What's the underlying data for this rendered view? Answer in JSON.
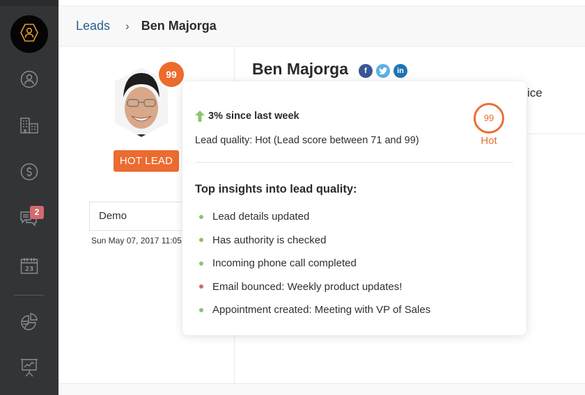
{
  "sidebar": {
    "items": [
      {
        "name": "home",
        "icon": "hexagon-user-icon",
        "active": true
      },
      {
        "name": "contacts",
        "icon": "user-circle-icon"
      },
      {
        "name": "accounts",
        "icon": "buildings-icon"
      },
      {
        "name": "deals",
        "icon": "dollar-circle-icon"
      },
      {
        "name": "messages",
        "icon": "chat-bubbles-icon",
        "badge": "2"
      },
      {
        "name": "calendar",
        "icon": "calendar-icon",
        "calendar_day": "23"
      },
      {
        "name": "reports",
        "icon": "pie-chart-icon"
      },
      {
        "name": "analytics",
        "icon": "presentation-chart-icon"
      }
    ]
  },
  "breadcrumb": {
    "parent": "Leads",
    "separator": "›",
    "current": "Ben Majorga"
  },
  "lead": {
    "name": "Ben Majorga",
    "score": "99",
    "status_label": "HOT LEAD",
    "social": {
      "facebook": "f",
      "twitter": "t",
      "linkedin": "in"
    },
    "partial_text": "ice"
  },
  "left_panel": {
    "stage_value": "Demo",
    "date": "Sun May 07, 2017 11:05"
  },
  "popover": {
    "trend": "3% since last week",
    "quality_text": "Lead quality: Hot (Lead score between 71 and 99)",
    "score": "99",
    "score_label": "Hot",
    "insights_title": "Top insights into lead quality:",
    "insights": [
      {
        "text": "Lead details updated",
        "sentiment": "positive"
      },
      {
        "text": "Has authority is checked",
        "sentiment": "positive"
      },
      {
        "text": "Incoming phone call completed",
        "sentiment": "positive"
      },
      {
        "text": "Email bounced: Weekly product updates!",
        "sentiment": "negative"
      },
      {
        "text": "Appointment created: Meeting with VP of Sales",
        "sentiment": "positive"
      }
    ]
  },
  "colors": {
    "accent": "#ec6b2d",
    "positive": "#8cc46a",
    "negative": "#d06a6e",
    "link": "#2a5f8f",
    "sidebar": "#333436",
    "badge": "#d06a6e"
  }
}
